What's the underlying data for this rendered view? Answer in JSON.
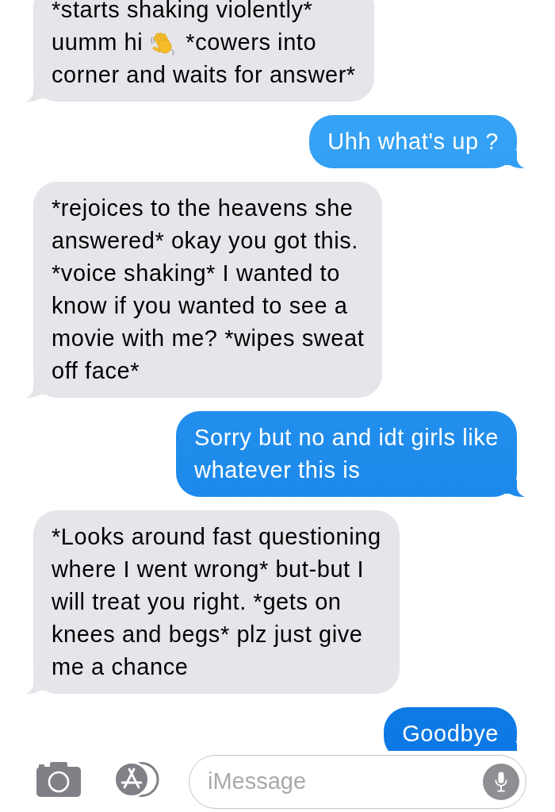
{
  "messages": [
    {
      "kind": "received",
      "parts": [
        {
          "kind": "text",
          "text": "*starts shaking violently*\nuumm hi"
        },
        {
          "kind": "emoji"
        },
        {
          "kind": "text",
          "text": "*cowers into\ncorner and waits for answer*"
        }
      ]
    },
    {
      "kind": "sent",
      "text": "Uhh what's up ?"
    },
    {
      "kind": "received",
      "text": "*rejoices to the heavens she\nanswered* okay you got this.\n*voice shaking* I wanted to\nknow if you wanted to see a\nmovie with me? *wipes sweat\noff face*"
    },
    {
      "kind": "sent",
      "text": "Sorry but no and idt girls like\nwhatever this is"
    },
    {
      "kind": "received",
      "text": "*Looks around fast questioning\nwhere I went wrong* but-but I\nwill treat you right. *gets on\nknees and begs* plz just give\nme a chance"
    },
    {
      "kind": "sent",
      "text": "Goodbye"
    }
  ],
  "composer": {
    "placeholder": "iMessage"
  }
}
